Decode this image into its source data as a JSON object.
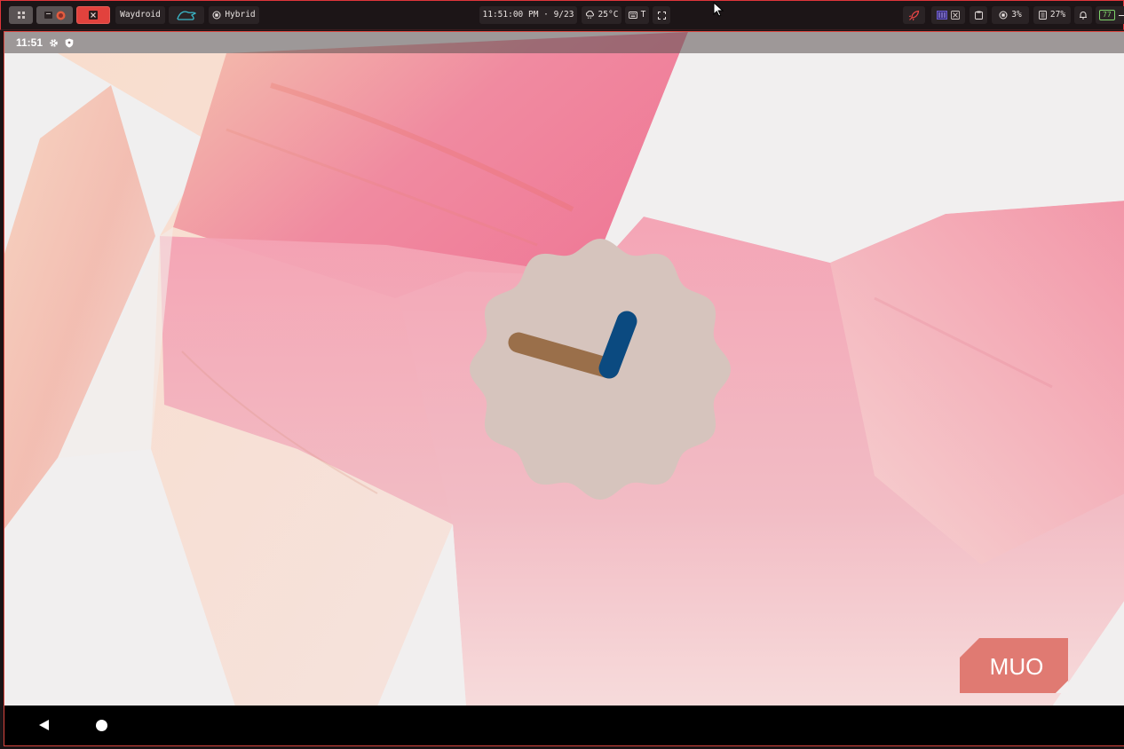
{
  "topbar": {
    "window_title": "Waydroid",
    "mode_label": "Hybrid",
    "datetime": "11:51:00 PM · 9/23",
    "weather": "25°C",
    "keyboard_layout": "T",
    "cpu": "3%",
    "memory": "27%",
    "battery": "77"
  },
  "android": {
    "status_time": "11:51"
  },
  "watermark": {
    "text": "MUO"
  },
  "colors": {
    "bar_bg": "#1c1517",
    "accent_red": "#e2423d",
    "clock_face": "#d6c4bd",
    "hour_hand": "#9a6f4a",
    "minute_hand": "#0b4a80",
    "watermark_bg": "#e07a72"
  }
}
